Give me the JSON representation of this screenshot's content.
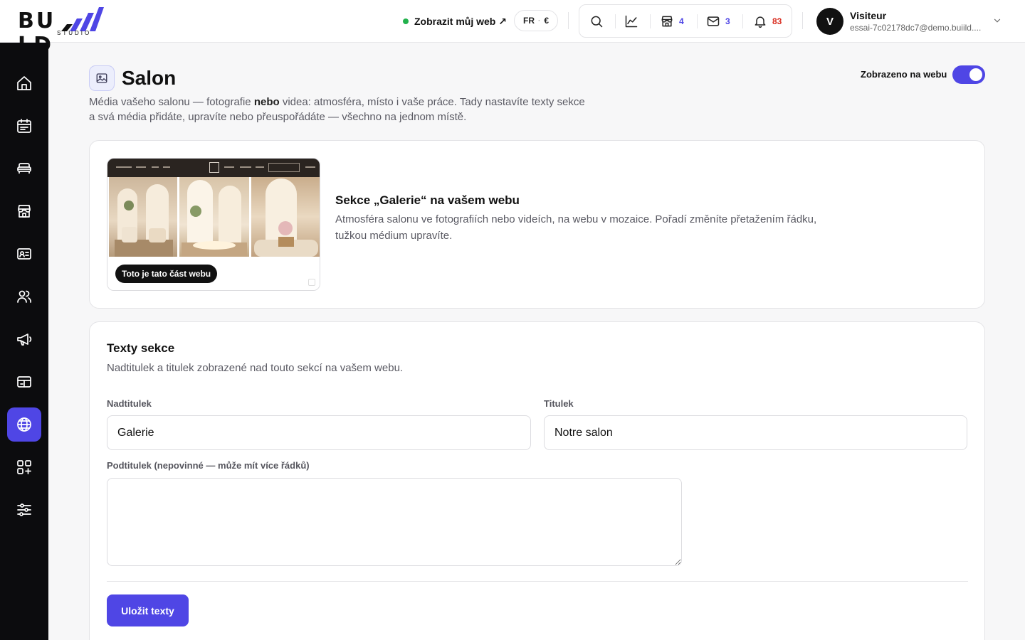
{
  "brand": {
    "wordmark_left": "BU",
    "wordmark_right": "LD",
    "sub": "STUDIO",
    "accent": "#4f46e5"
  },
  "header": {
    "view_site_label": "Zobrazit můj web ↗",
    "lang": "FR",
    "currency": "€",
    "counts": {
      "shop": "4",
      "mail": "3",
      "notifications": "83"
    },
    "user": {
      "initial": "V",
      "name": "Visiteur",
      "email": "essai-7c02178dc7@demo.buiild...."
    }
  },
  "sidebar": {
    "items": [
      {
        "icon": "home-icon"
      },
      {
        "icon": "calendar-icon"
      },
      {
        "icon": "services-icon"
      },
      {
        "icon": "store-icon"
      },
      {
        "icon": "id-card-icon"
      },
      {
        "icon": "users-icon"
      },
      {
        "icon": "megaphone-icon"
      },
      {
        "icon": "gift-card-icon"
      },
      {
        "icon": "globe-icon",
        "active": true
      },
      {
        "icon": "apps-add-icon"
      },
      {
        "icon": "settings-sliders-icon"
      }
    ]
  },
  "page": {
    "title": "Salon",
    "desc_before": "Média vašeho salonu — fotografie ",
    "desc_bold": "nebo",
    "desc_after": " videa: atmosféra, místo i vaše práce. Tady nastavíte texty sekce a svá média přidáte, upravíte nebo přeuspořádáte — všechno na jednom místě.",
    "visibility_label": "Zobrazeno na webu",
    "visibility_on": true
  },
  "section_card": {
    "preview_chip": "Toto je tato část webu",
    "title": "Sekce „Galerie“ na vašem webu",
    "desc": "Atmosféra salonu ve fotografiích nebo videích, na webu v mozaice. Pořadí změníte přetažením řádku, tužkou médium upravíte."
  },
  "texts_card": {
    "title": "Texty sekce",
    "desc": "Nadtitulek a titulek zobrazené nad touto sekcí na vašem webu.",
    "overline_label": "Nadtitulek",
    "overline_value": "Galerie",
    "title_label": "Titulek",
    "title_value": "Notre salon",
    "subtitle_label": "Podtitulek (nepovinné — může mít více řádků)",
    "subtitle_value": "",
    "save_label": "Uložit texty"
  }
}
